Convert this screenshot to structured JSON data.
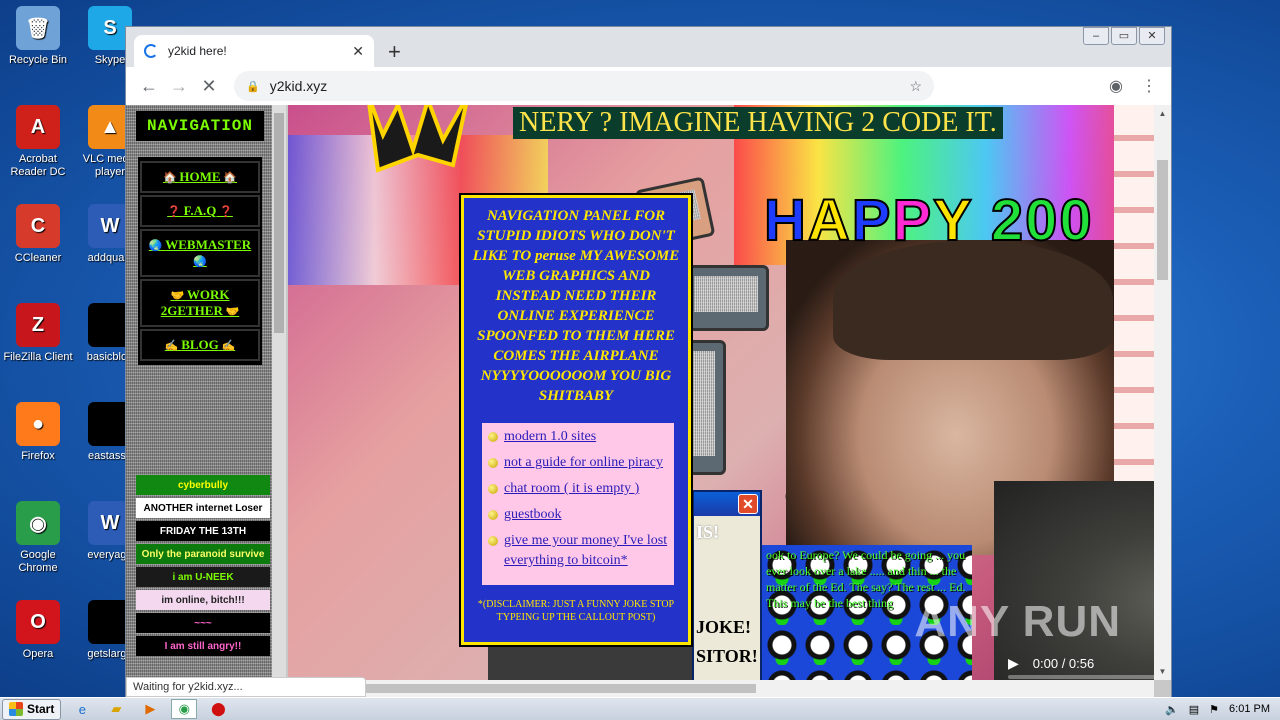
{
  "desktop": {
    "icons": [
      {
        "label": "Recycle Bin",
        "glyph": "🗑",
        "color": "#6fa3d8"
      },
      {
        "label": "Acrobat Reader DC",
        "glyph": "A",
        "color": "#d0201a"
      },
      {
        "label": "CCleaner",
        "glyph": "C",
        "color": "#d63a2a"
      },
      {
        "label": "FileZilla Client",
        "glyph": "Z",
        "color": "#c8161d"
      },
      {
        "label": "Firefox",
        "glyph": "●",
        "color": "#ff7a1a"
      },
      {
        "label": "Google Chrome",
        "glyph": "◉",
        "color": "#2a9d4a"
      },
      {
        "label": "Opera",
        "glyph": "O",
        "color": "#d2141c"
      }
    ],
    "icons_col2": [
      {
        "label": "Skype",
        "glyph": "S",
        "color": "#1ea8e8"
      },
      {
        "label": "VLC media player",
        "glyph": "▲",
        "color": "#f28a17"
      },
      {
        "label": "addqualit",
        "glyph": "W",
        "color": "#2c5cb5"
      },
      {
        "label": "basicblog",
        "glyph": "",
        "color": "#000000"
      },
      {
        "label": "eastasso",
        "glyph": "",
        "color": "#000000"
      },
      {
        "label": "everyaga",
        "glyph": "W",
        "color": "#2c5cb5"
      },
      {
        "label": "getslarge",
        "glyph": "",
        "color": "#000000"
      }
    ]
  },
  "browser": {
    "tab_title": "y2kid here!",
    "url": "y2kid.xyz",
    "status_text": "Waiting for y2kid.xyz..."
  },
  "site": {
    "nav_heading": "NAVIGATION",
    "nav_items": [
      {
        "label": "HOME",
        "emoji": "🏠"
      },
      {
        "label": "F.A.Q",
        "emoji": "❓"
      },
      {
        "label": "WEBMASTER",
        "emoji": "🌏"
      },
      {
        "label": "WORK 2GETHER",
        "emoji": "🤝"
      },
      {
        "label": "BLOG",
        "emoji": "✍"
      }
    ],
    "buttons": [
      {
        "label": "cyberbully",
        "bg": "#118811",
        "fg": "#ffff00"
      },
      {
        "label": "ANOTHER internet Loser",
        "bg": "#ffffff",
        "fg": "#000000"
      },
      {
        "label": "FRIDAY THE 13TH",
        "bg": "#000000",
        "fg": "#ffffff"
      },
      {
        "label": "Only the paranoid survive",
        "bg": "#0c7a0c",
        "fg": "#ffff66"
      },
      {
        "label": "i am U-NEEK",
        "bg": "#1a1a1a",
        "fg": "#7cfc00"
      },
      {
        "label": "im online, bitch!!!",
        "bg": "#f4d8f0",
        "fg": "#222222"
      },
      {
        "label": "~~~",
        "bg": "#000000",
        "fg": "#ff66cc"
      },
      {
        "label": "I am still angry!!",
        "bg": "#000000",
        "fg": "#ff66cc"
      }
    ],
    "banner": "NERY ? IMAGINE HAVING 2 CODE IT.",
    "happy_letters": [
      "H",
      "A",
      "P",
      "P",
      "Y",
      " 200"
    ],
    "panel_text": "NAVIGATION PANEL FOR STUPID IDIOTS WHO DON'T LIKE TO peruse MY AWESOME WEB GRAPHICS AND INSTEAD NEED THEIR ONLINE EXPERIENCE SPOONFED TO THEM HERE COMES THE AIRPLANE NYYYYOOOOOOM YOU BIG SHITBABY",
    "panel_links": [
      "modern 1.0 sites",
      "not a guide for online piracy",
      "chat room ( it is empty )",
      "guestbook",
      "give me your money I've lost everything to bitcoin*"
    ],
    "disclaimer": "*(DISCLAIMER: JUST A FUNNY JOKE STOP TYPEING UP THE CALLOUT POST)",
    "dialog_fragments": [
      "IS!",
      "JOKE!",
      "SITOR!"
    ],
    "ducks_text": "ook to Europe? We could be going ... you ever look over a lake ..... and thin ... the matter of the Ed. The say? The rest ... Ed. This may be the best thing",
    "video": {
      "time": "0:00 / 0:56",
      "progress": 0.0
    }
  },
  "taskbar": {
    "start_label": "Start",
    "clock": "6:01 PM"
  },
  "watermark": "ANY RUN"
}
